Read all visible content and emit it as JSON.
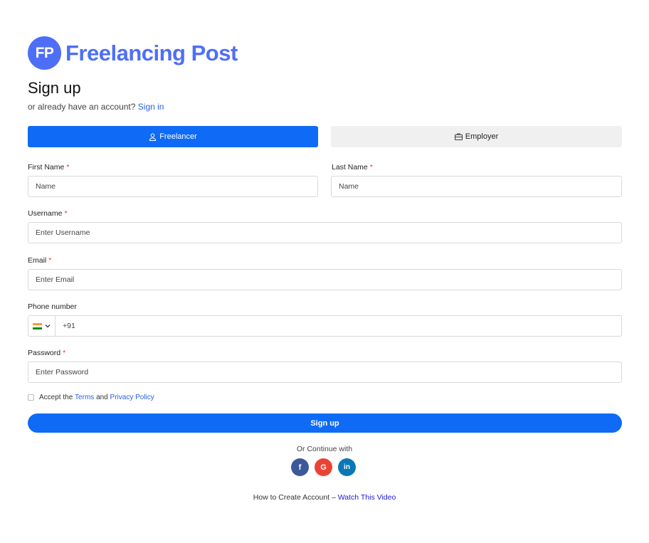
{
  "logo": {
    "mark": "FP",
    "name": "Freelancing Post"
  },
  "heading": {
    "title": "Sign up",
    "subtitle": "or already have an account?",
    "signin_link": "Sign in"
  },
  "roles": {
    "freelancer": "Freelancer",
    "employer": "Employer"
  },
  "form": {
    "first_name": {
      "label": "First Name",
      "required": "*",
      "placeholder": "Name"
    },
    "last_name": {
      "label": "Last Name",
      "required": "*",
      "placeholder": "Name"
    },
    "username": {
      "label": "Username",
      "required": "*",
      "placeholder": "Enter Username"
    },
    "email": {
      "label": "Email",
      "required": "*",
      "placeholder": "Enter Email"
    },
    "phone": {
      "label": "Phone number",
      "country_icon": "india-flag-icon",
      "value": "+91"
    },
    "password": {
      "label": "Password",
      "required": "*",
      "placeholder": "Enter Password"
    }
  },
  "terms": {
    "prefix": "Accept the",
    "terms_link": "Terms",
    "and": "and",
    "privacy_link": "Privacy Policy"
  },
  "submit_label": "Sign up",
  "continue_with": "Or Continue with",
  "socials": {
    "facebook": {
      "glyph": "f",
      "color": "#3b5998"
    },
    "google": {
      "glyph": "G",
      "color": "#ea4335"
    },
    "linkedin": {
      "glyph": "in",
      "color": "#0a78b5"
    }
  },
  "howto": {
    "text": "How to Create Account –",
    "link": "Watch This Video"
  },
  "colors": {
    "primary": "#0f6bf5",
    "brand": "#4f6ef7",
    "required": "#e53935"
  }
}
